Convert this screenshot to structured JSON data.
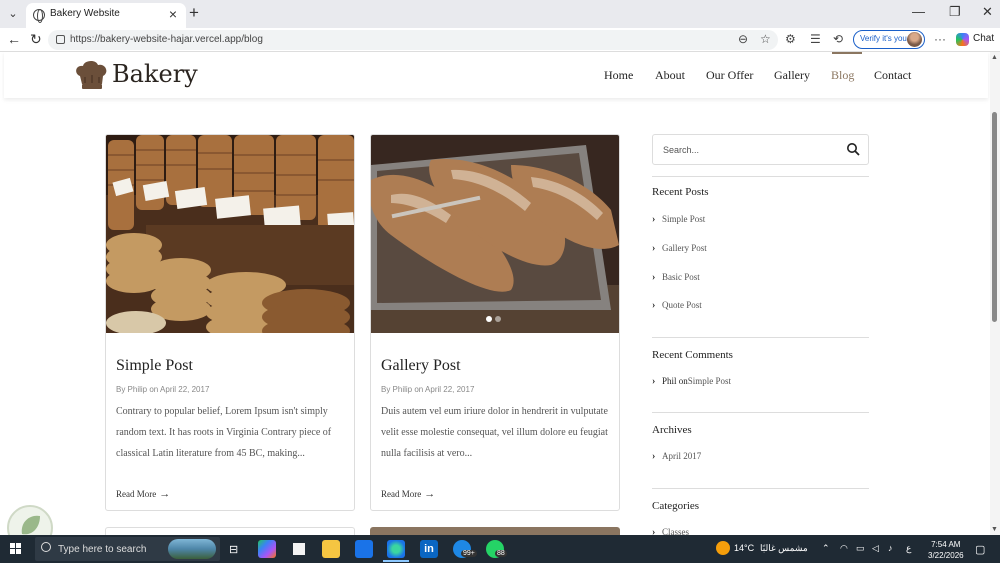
{
  "browser": {
    "tab_title": "Bakery Website",
    "url": "https://bakery-website-hajar.vercel.app/blog",
    "verify_label": "Verify it's you",
    "chat_label": "Chat"
  },
  "site": {
    "logo": "Bakery",
    "menu": [
      "Home",
      "About",
      "Our Offer",
      "Gallery",
      "Blog",
      "Contact"
    ],
    "active_menu": "Blog",
    "accent_color": "#8b7660"
  },
  "posts": [
    {
      "title": "Simple Post",
      "meta": "By Philip on April 22, 2017",
      "excerpt": "Contrary to popular belief, Lorem Ipsum isn't simply random text. It has roots in Virginia Contrary piece of classical Latin literature from 45 BC, making...",
      "more": "Read More"
    },
    {
      "title": "Gallery Post",
      "meta": "By Philip on April 22, 2017",
      "excerpt": "Duis autem vel eum iriure dolor in hendrerit in vulputate velit esse molestie consequat, vel illum dolore eu feugiat nulla facilisis at vero...",
      "more": "Read More"
    }
  ],
  "sidebar": {
    "search_placeholder": "Search...",
    "recent_posts_heading": "Recent Posts",
    "recent_posts": [
      "Simple Post",
      "Gallery Post",
      "Basic Post",
      "Quote Post"
    ],
    "recent_comments_heading": "Recent Comments",
    "comment_author": "Phil",
    "comment_connector": "on",
    "comment_post": "Simple Post",
    "archives_heading": "Archives",
    "archives": [
      "April 2017"
    ],
    "categories_heading": "Categories",
    "categories": [
      "Classes"
    ]
  },
  "taskbar": {
    "search_text": "Type here to search",
    "weather": "14°C",
    "weather_desc": "مشمس غالبًا",
    "lang": "ع",
    "time": "7:54 AM",
    "date": "3/22/2026",
    "badge_ie": "99+",
    "badge_whatsapp": "88"
  }
}
